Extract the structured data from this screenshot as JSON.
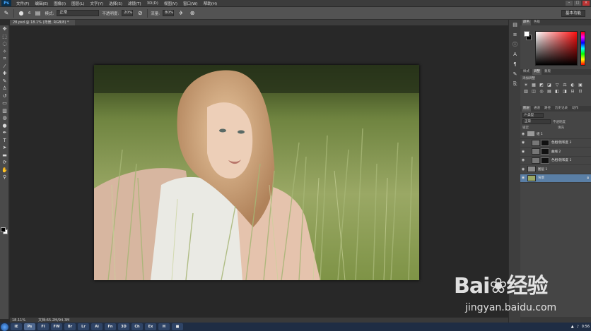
{
  "app": {
    "logo_text": "Ps"
  },
  "menu": [
    "文件(F)",
    "编辑(E)",
    "图像(I)",
    "图层(L)",
    "文字(Y)",
    "选择(S)",
    "滤镜(T)",
    "3D(D)",
    "视图(V)",
    "窗口(W)",
    "帮助(H)"
  ],
  "options_bar": {
    "brush_size": "6",
    "mode_label": "模式:",
    "mode_value": "正常",
    "opacity_label": "不透明度:",
    "opacity_value": "20%",
    "flow_label": "流量:",
    "flow_value": "80%",
    "workspace_label": "基本功能"
  },
  "document": {
    "tab_title": "28.psd @ 18.1% (背景, RGB/8) *"
  },
  "status_bar": {
    "zoom": "18.11%",
    "doc_info": "文档:65.2M/94.3M"
  },
  "color_panel": {
    "tabs": [
      "颜色",
      "色板"
    ]
  },
  "adjustments_panel": {
    "tabs": [
      "样式",
      "调整",
      "蒙版"
    ],
    "title": "添加调整",
    "icons": [
      "☀",
      "▦",
      "◩",
      "◪",
      "▽",
      "⚖",
      "◐",
      "▣",
      "▥",
      "◫",
      "◎",
      "▤",
      "◧",
      "◨",
      "⊟",
      "⊡"
    ]
  },
  "layers_panel": {
    "tabs": [
      "图层",
      "通道",
      "路径",
      "历史记录",
      "动作"
    ],
    "filter_label": "P 类型",
    "blend_mode": "正常",
    "opacity_label": "不透明度",
    "lock_label": "锁定",
    "fill_label": "填充",
    "layers": [
      {
        "name": "组 1",
        "kind": "group",
        "selected": false
      },
      {
        "name": "色相/饱和度 3",
        "kind": "adjustment",
        "selected": false
      },
      {
        "name": "曲线 2",
        "kind": "adjustment",
        "selected": false
      },
      {
        "name": "色相/饱和度 1",
        "kind": "adjustment",
        "selected": false
      },
      {
        "name": "图层 1",
        "kind": "pixel",
        "selected": false
      },
      {
        "name": "背景",
        "kind": "background",
        "selected": true
      }
    ]
  },
  "taskbar": {
    "apps": [
      "IE",
      "Ps",
      "Fl",
      "FW",
      "Br",
      "Lr",
      "Ai",
      "Fn",
      "3D",
      "Ch",
      "Ex",
      "H",
      "■"
    ],
    "clock": "0:56"
  },
  "watermark": {
    "logo": "Baidu经验",
    "sub": "jingyan.baidu.com"
  },
  "colors": {
    "accent": "#5a7fa6",
    "taskbar": "#1f2d44",
    "canvas_bg": "#282828"
  }
}
